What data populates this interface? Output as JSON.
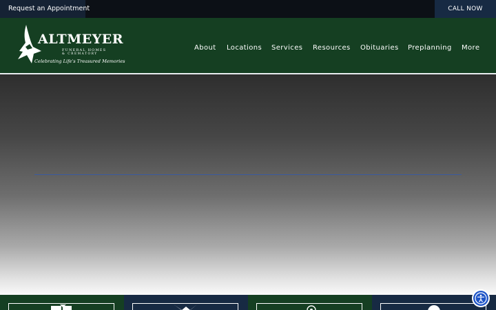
{
  "topbar": {
    "appointment_label": "Request an Appointment",
    "call_label": "CALL NOW"
  },
  "logo": {
    "word": "ALTMEYER",
    "sub1": "FUNERAL HOMES",
    "sub2": "& CREMATORY",
    "tagline": "Celebrating Life's Treasured Memories"
  },
  "nav": {
    "items": [
      {
        "label": "About"
      },
      {
        "label": "Locations"
      },
      {
        "label": "Services"
      },
      {
        "label": "Resources"
      },
      {
        "label": "Obituaries"
      },
      {
        "label": "Preplanning"
      },
      {
        "label": "More"
      }
    ]
  },
  "tiles": [
    {
      "icon": "document-icon",
      "color": "#153f22"
    },
    {
      "icon": "bird-icon",
      "color": "#172a43"
    },
    {
      "icon": "flower-icon",
      "color": "#153f22"
    },
    {
      "icon": "chat-icon",
      "color": "#172a43"
    }
  ],
  "colors": {
    "header_green": "#153f22",
    "navy": "#172a43",
    "accessibility_blue": "#1f55c7"
  }
}
